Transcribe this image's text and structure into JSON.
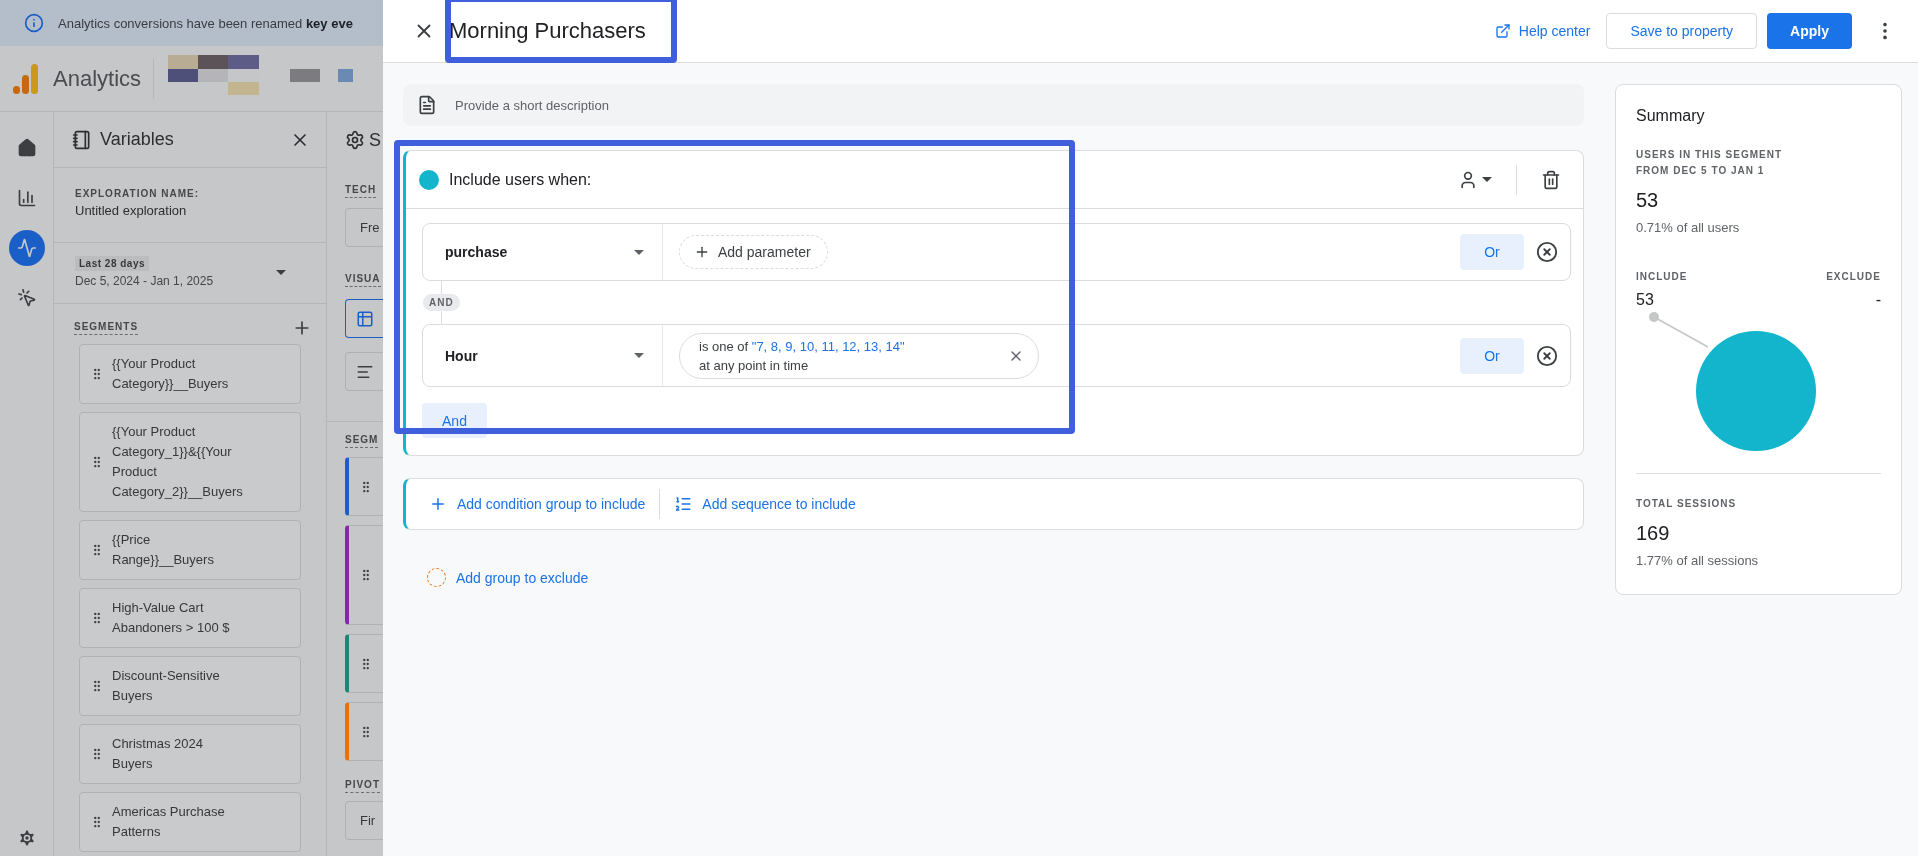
{
  "banner": {
    "text": "Analytics conversions have been renamed **key eve**"
  },
  "app_header": {
    "product": "Analytics"
  },
  "nav": {
    "items": [
      {
        "kind": "home",
        "selected": false
      },
      {
        "kind": "reports",
        "selected": false
      },
      {
        "kind": "explore",
        "selected": true
      },
      {
        "kind": "advertising",
        "selected": false
      }
    ]
  },
  "variables": {
    "title": "Variables",
    "exploration_name_label": "EXPLORATION NAME:",
    "exploration_name": "Untitled exploration",
    "date_preset": "Last 28 days",
    "date_range": "Dec 5, 2024 - Jan 1, 2025",
    "segments_label": "SEGMENTS",
    "segments": [
      "{{Your Product Category}}__Buyers",
      "{{Your Product Category_1}}&{{Your Product Category_2}}__Buyers",
      "{{Price Range}}__Buyers",
      "High-Value Cart Abandoners > 100 $",
      "Discount-Sensitive Buyers",
      "Christmas 2024 Buyers",
      "Americas Purchase Patterns"
    ]
  },
  "settings_column": {
    "title": "S",
    "technique_label": "TECH",
    "technique_value": "Fre",
    "visualization_label": "VISUA",
    "visualizations": [
      {
        "kind": "table",
        "selected": true
      },
      {
        "kind": "bar",
        "selected": false
      }
    ],
    "segments_label": "SEGM",
    "segment_cards": [
      {
        "color": "#1a5fc8"
      },
      {
        "color": "#8e24aa"
      },
      {
        "color": "#168a78"
      },
      {
        "color": "#e8710a"
      }
    ],
    "pivot_label": "PIVOT",
    "pivot_value": "Fir"
  },
  "segment_editor": {
    "title": "Morning Purchasers",
    "help_link": "Help center",
    "save_button": "Save to property",
    "apply_button": "Apply",
    "description_placeholder": "Provide a short description",
    "include_group": {
      "title": "Include users when:",
      "conditions": [
        {
          "kind": "event",
          "dimension": "purchase",
          "add_parameter": "Add parameter",
          "or_button": "Or"
        },
        {
          "kind": "filter",
          "dimension": "Hour",
          "filter_prefix": "is one of ",
          "filter_values": "\"7, 8, 9, 10, 11, 12, 13, 14\"",
          "filter_scope": "at any point in time",
          "or_button": "Or"
        }
      ],
      "connector": "AND",
      "and_button": "And"
    },
    "add_condition_group": "Add condition group to include",
    "add_sequence": "Add sequence to include",
    "add_exclude_group": "Add group to exclude"
  },
  "summary": {
    "title": "Summary",
    "users_label_1": "USERS IN THIS SEGMENT",
    "users_label_2": "FROM DEC 5 TO JAN 1",
    "users_value": "53",
    "users_share": "0.71% of all users",
    "include_label": "INCLUDE",
    "include_value": "53",
    "exclude_label": "EXCLUDE",
    "exclude_value": "-",
    "sessions_label": "TOTAL SESSIONS",
    "sessions_value": "169",
    "sessions_share": "1.77% of all sessions"
  }
}
